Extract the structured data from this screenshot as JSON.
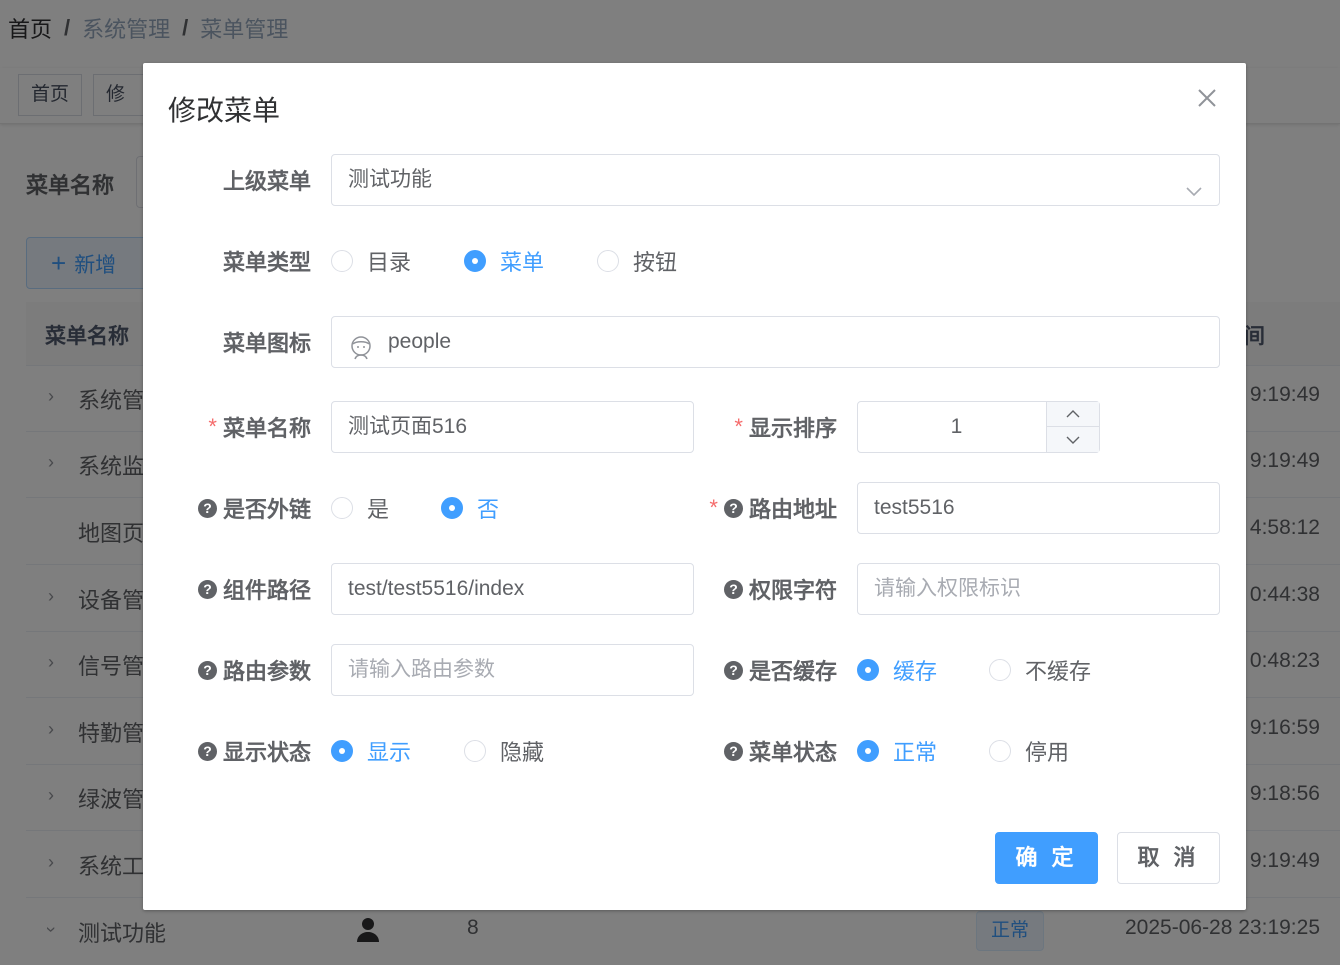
{
  "breadcrumb": [
    "首页",
    "系统管理",
    "菜单管理"
  ],
  "tags": [
    "首页",
    "修改"
  ],
  "search": {
    "label": "菜单名称"
  },
  "toolbar": {
    "add_label": "新增"
  },
  "table": {
    "header_name": "菜单名称",
    "header_time_fragment": "间",
    "rows": [
      {
        "name": "系统管",
        "time": "9:19:49"
      },
      {
        "name": "系统监",
        "time": "9:19:49"
      },
      {
        "name": "地图页",
        "time": "4:58:12"
      },
      {
        "name": "设备管",
        "time": "0:44:38"
      },
      {
        "name": "信号管",
        "time": "0:48:23"
      },
      {
        "name": "特勤管",
        "time": "9:16:59"
      },
      {
        "name": "绿波管",
        "time": "9:18:56"
      },
      {
        "name": "系统工",
        "time": "9:19:49"
      },
      {
        "name": "测试功能",
        "order": "8",
        "status": "正常",
        "time": "2025-06-28 23:19:25"
      }
    ]
  },
  "dialog": {
    "title": "修改菜单",
    "parent": {
      "label": "上级菜单",
      "value": "测试功能"
    },
    "menu_type": {
      "label": "菜单类型",
      "options": [
        "目录",
        "菜单",
        "按钮"
      ],
      "selected": "菜单"
    },
    "icon": {
      "label": "菜单图标",
      "value": "people",
      "icon": "people-icon"
    },
    "menu_name": {
      "label": "菜单名称",
      "value": "测试页面516"
    },
    "order": {
      "label": "显示排序",
      "value": "1"
    },
    "is_frame": {
      "label": "是否外链",
      "options": [
        "是",
        "否"
      ],
      "selected": "否"
    },
    "path": {
      "label": "路由地址",
      "value": "test5516"
    },
    "component": {
      "label": "组件路径",
      "value": "test/test5516/index"
    },
    "perms": {
      "label": "权限字符",
      "placeholder": "请输入权限标识"
    },
    "query": {
      "label": "路由参数",
      "placeholder": "请输入路由参数"
    },
    "cache": {
      "label": "是否缓存",
      "options": [
        "缓存",
        "不缓存"
      ],
      "selected": "缓存"
    },
    "visible": {
      "label": "显示状态",
      "options": [
        "显示",
        "隐藏"
      ],
      "selected": "显示"
    },
    "status": {
      "label": "菜单状态",
      "options": [
        "正常",
        "停用"
      ],
      "selected": "正常"
    },
    "confirm_label": "确 定",
    "cancel_label": "取 消"
  }
}
